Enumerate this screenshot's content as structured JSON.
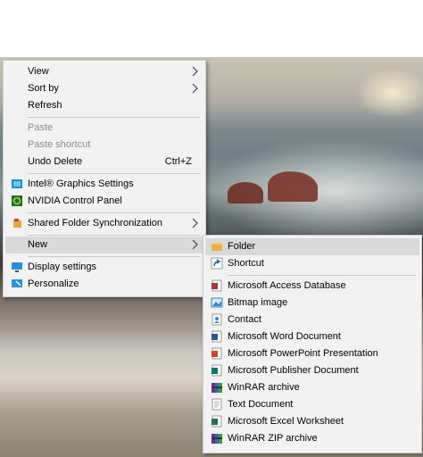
{
  "context_menu": {
    "items": [
      {
        "label": "View"
      },
      {
        "label": "Sort by"
      },
      {
        "label": "Refresh"
      },
      {
        "label": "Paste"
      },
      {
        "label": "Paste shortcut"
      },
      {
        "label": "Undo Delete",
        "shortcut": "Ctrl+Z"
      },
      {
        "label": "Intel® Graphics Settings"
      },
      {
        "label": "NVIDIA Control Panel"
      },
      {
        "label": "Shared Folder Synchronization"
      },
      {
        "label": "New"
      },
      {
        "label": "Display settings"
      },
      {
        "label": "Personalize"
      }
    ]
  },
  "new_submenu": {
    "items": [
      {
        "label": "Folder"
      },
      {
        "label": "Shortcut"
      },
      {
        "label": "Microsoft Access Database"
      },
      {
        "label": "Bitmap image"
      },
      {
        "label": "Contact"
      },
      {
        "label": "Microsoft Word Document"
      },
      {
        "label": "Microsoft PowerPoint Presentation"
      },
      {
        "label": "Microsoft Publisher Document"
      },
      {
        "label": "WinRAR archive"
      },
      {
        "label": "Text Document"
      },
      {
        "label": "Microsoft Excel Worksheet"
      },
      {
        "label": "WinRAR ZIP archive"
      }
    ]
  },
  "colors": {
    "menu_background": "#f2f2f2",
    "hover_background": "#d9d9d9",
    "disabled_text": "#8a8a8a"
  }
}
